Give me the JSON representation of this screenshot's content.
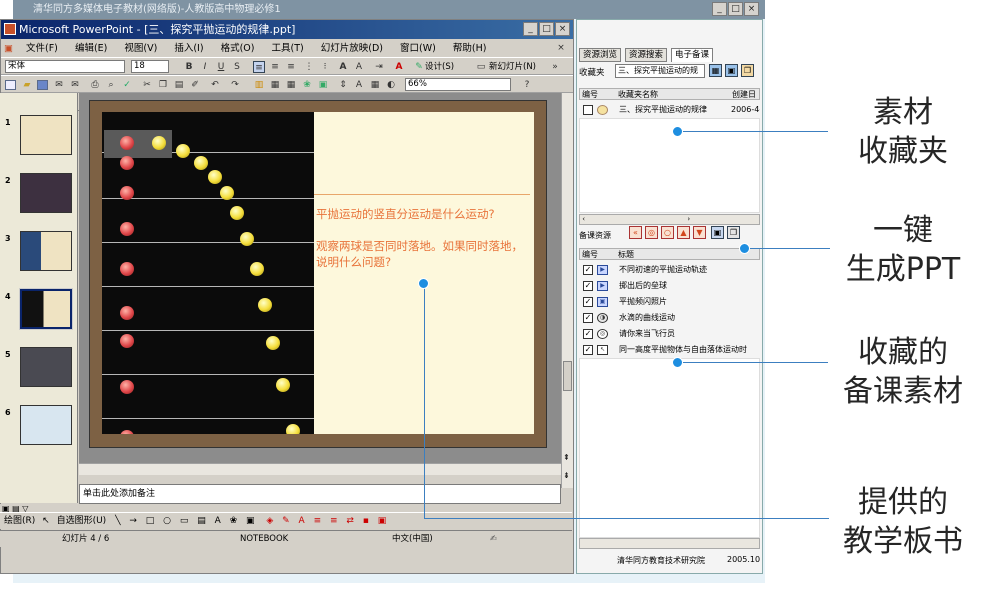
{
  "outer_window": {
    "title": "清华同方多媒体电子教材(网络版)-人教版高中物理必修1"
  },
  "ppt": {
    "title": "Microsoft PowerPoint - [三、探究平抛运动的规律.ppt]",
    "menu": [
      "文件(F)",
      "编辑(E)",
      "视图(V)",
      "插入(I)",
      "格式(O)",
      "工具(T)",
      "幻灯片放映(D)",
      "窗口(W)",
      "帮助(H)"
    ],
    "font_name": "宋体",
    "font_size": "18",
    "design_label": "设计(S)",
    "new_slide_label": "新幻灯片(N)",
    "zoom": "66%",
    "slide_numbers": [
      "1",
      "2",
      "3",
      "4",
      "5",
      "6"
    ],
    "selected_slide": 4,
    "slide_text_1": "平抛运动的竖直分运动是什么运动?",
    "slide_text_2": "观察两球是否同时落地。如果同时落地，说明什么问题?",
    "notes_placeholder": "单击此处添加备注",
    "draw_label": "绘图(R)",
    "autoshape_label": "自选图形(U)",
    "status_slide": "幻灯片 4 / 6",
    "status_design": "NOTEBOOK",
    "status_lang": "中文(中国)"
  },
  "side_panel": {
    "tabs": [
      "资源浏览",
      "资源搜索",
      "电子备课"
    ],
    "active_tab": 2,
    "folder_label": "收藏夹",
    "folder_value": "三、探究平抛运动的规",
    "folder_columns": [
      "编号",
      "收藏夹名称",
      "创建日"
    ],
    "folder_rows": [
      {
        "name": "三、探究平抛运动的规律",
        "date": "2006-4-"
      }
    ],
    "resource_label": "备课资源",
    "resource_columns": [
      "编号",
      "标题"
    ],
    "resource_rows": [
      "不同初速的平抛运动轨迹",
      "掷出后的垒球",
      "平抛频闪照片",
      "水滴的曲线运动",
      "请你来当飞行员",
      "同一高度平抛物体与自由落体运动时"
    ],
    "footer": "清华同方教育技术研究院",
    "footer_year": "2005.10"
  },
  "annotations": [
    {
      "text_line1": "素材",
      "text_line2": "收藏夹"
    },
    {
      "text_line1": "一键",
      "text_line2": "生成PPT"
    },
    {
      "text_line1": "收藏的",
      "text_line2": "备课素材"
    },
    {
      "text_line1": "提供的",
      "text_line2": "教学板书"
    }
  ]
}
